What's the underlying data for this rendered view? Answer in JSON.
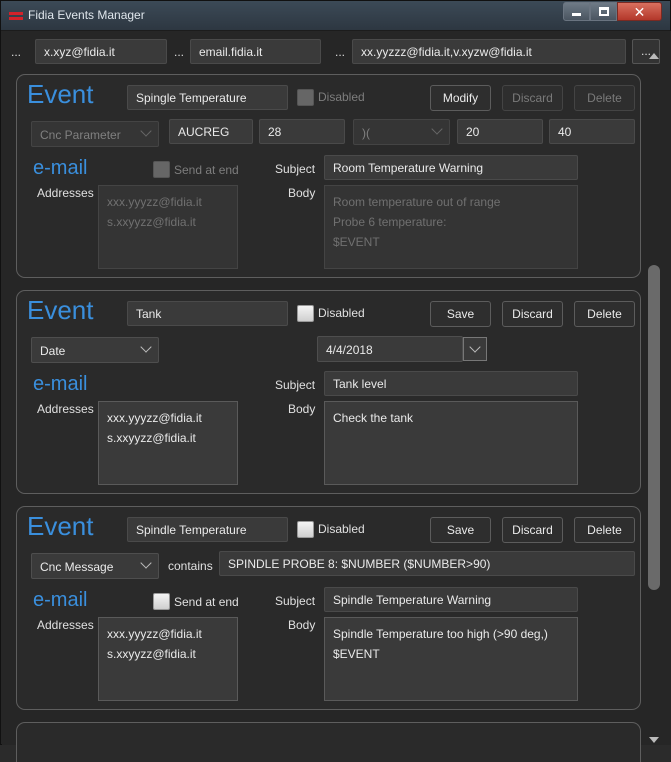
{
  "window": {
    "title": "Fidia Events Manager"
  },
  "top_bar": {
    "fields": [
      "x.xyz@fidia.it",
      "email.fidia.it",
      "xx.yyzzz@fidia.it,v.xyzw@fidia.it"
    ],
    "dots": "..."
  },
  "events": [
    {
      "section_label": "Event",
      "name": "Spingle Temperature",
      "disabled_label": "Disabled",
      "buttons": [
        "Modify",
        "Discard",
        "Delete"
      ],
      "trigger_type": "Cnc Parameter",
      "param_name": "AUCREG",
      "param_index": "28",
      "operator": ")(",
      "value_low": "20",
      "value_high": "40",
      "email_label": "e-mail",
      "send_at_end_label": "Send at end",
      "addresses_label": "Addresses",
      "addresses": [
        "xxx.yyyzz@fidia.it",
        "s.xxyyzz@fidia.it"
      ],
      "subject_label": "Subject",
      "subject": "Room Temperature Warning",
      "body_label": "Body",
      "body": [
        "Room temperature out of range",
        "Probe 6 temperature:",
        "$EVENT"
      ]
    },
    {
      "section_label": "Event",
      "name": "Tank",
      "disabled_label": "Disabled",
      "buttons": [
        "Save",
        "Discard",
        "Delete"
      ],
      "trigger_type": "Date",
      "date": "4/4/2018",
      "email_label": "e-mail",
      "addresses_label": "Addresses",
      "addresses": [
        "xxx.yyyzz@fidia.it",
        "s.xxyyzz@fidia.it"
      ],
      "subject_label": "Subject",
      "subject": "Tank level",
      "body_label": "Body",
      "body": [
        "Check the tank"
      ]
    },
    {
      "section_label": "Event",
      "name": "Spindle Temperature",
      "disabled_label": "Disabled",
      "buttons": [
        "Save",
        "Discard",
        "Delete"
      ],
      "trigger_type": "Cnc Message",
      "contains_label": "contains",
      "message": "SPINDLE PROBE 8: $NUMBER ($NUMBER>90)",
      "email_label": "e-mail",
      "send_at_end_label": "Send at end",
      "addresses_label": "Addresses",
      "addresses": [
        "xxx.yyyzz@fidia.it",
        "s.xxyyzz@fidia.it"
      ],
      "subject_label": "Subject",
      "subject": "Spindle Temperature Warning",
      "body_label": "Body",
      "body": [
        "Spindle Temperature too high (>90 deg,)",
        "$EVENT"
      ]
    }
  ]
}
